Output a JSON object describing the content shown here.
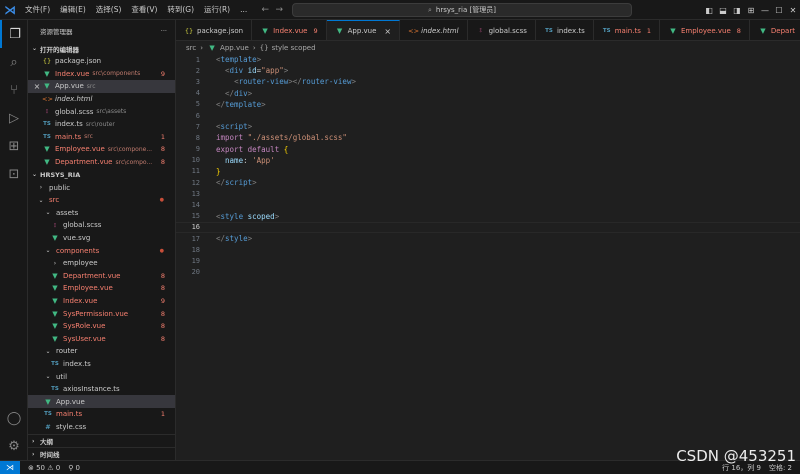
{
  "menu": [
    "文件(F)",
    "编辑(E)",
    "选择(S)",
    "查看(V)",
    "转到(G)",
    "运行(R)",
    "..."
  ],
  "command_center": "hrsys_ria [管理员]",
  "sidebar": {
    "title": "资源管理器",
    "more": "···",
    "open_editors_title": "打开的编辑器",
    "open_editors": [
      {
        "icon": "{}",
        "kind": "json",
        "name": "package.json",
        "dir": "",
        "badge": "",
        "state": ""
      },
      {
        "icon": "▼",
        "kind": "vue",
        "name": "Index.vue",
        "dir": "src\\components",
        "badge": "9",
        "state": "err"
      },
      {
        "icon": "▼",
        "kind": "vue",
        "name": "App.vue",
        "dir": "src",
        "badge": "",
        "state": "",
        "selected": true
      },
      {
        "icon": "<>",
        "kind": "html",
        "name": "index.html",
        "dir": "",
        "badge": "",
        "state": "ital"
      },
      {
        "icon": "⦂",
        "kind": "scss",
        "name": "global.scss",
        "dir": "src\\assets",
        "badge": "",
        "state": ""
      },
      {
        "icon": "TS",
        "kind": "ts",
        "name": "index.ts",
        "dir": "src\\router",
        "badge": "",
        "state": ""
      },
      {
        "icon": "TS",
        "kind": "ts",
        "name": "main.ts",
        "dir": "src",
        "badge": "1",
        "state": "err"
      },
      {
        "icon": "▼",
        "kind": "vue",
        "name": "Employee.vue",
        "dir": "src\\compone...",
        "badge": "8",
        "state": "err"
      },
      {
        "icon": "▼",
        "kind": "vue",
        "name": "Department.vue",
        "dir": "src\\compo...",
        "badge": "8",
        "state": "err"
      }
    ],
    "project_title": "HRSYS_RIA",
    "tree": [
      {
        "indent": 0,
        "icon": "›",
        "kind": "chev",
        "name": "public",
        "state": "",
        "badge": ""
      },
      {
        "indent": 0,
        "icon": "⌄",
        "kind": "chev",
        "name": "src",
        "state": "err",
        "badge": "",
        "dot": true
      },
      {
        "indent": 1,
        "icon": "⌄",
        "kind": "chev",
        "name": "assets",
        "state": "",
        "badge": ""
      },
      {
        "indent": 2,
        "icon": "⦂",
        "kind": "scss",
        "name": "global.scss",
        "state": "",
        "badge": ""
      },
      {
        "indent": 2,
        "icon": "▼",
        "kind": "vue",
        "name": "vue.svg",
        "state": "",
        "badge": ""
      },
      {
        "indent": 1,
        "icon": "⌄",
        "kind": "chev",
        "name": "components",
        "state": "err",
        "badge": "",
        "dot": true
      },
      {
        "indent": 2,
        "icon": "›",
        "kind": "chev",
        "name": "employee",
        "state": "",
        "badge": ""
      },
      {
        "indent": 2,
        "icon": "▼",
        "kind": "vue",
        "name": "Department.vue",
        "state": "err",
        "badge": "8"
      },
      {
        "indent": 2,
        "icon": "▼",
        "kind": "vue",
        "name": "Employee.vue",
        "state": "err",
        "badge": "8"
      },
      {
        "indent": 2,
        "icon": "▼",
        "kind": "vue",
        "name": "Index.vue",
        "state": "err",
        "badge": "9"
      },
      {
        "indent": 2,
        "icon": "▼",
        "kind": "vue",
        "name": "SysPermission.vue",
        "state": "err",
        "badge": "8"
      },
      {
        "indent": 2,
        "icon": "▼",
        "kind": "vue",
        "name": "SysRole.vue",
        "state": "err",
        "badge": "8"
      },
      {
        "indent": 2,
        "icon": "▼",
        "kind": "vue",
        "name": "SysUser.vue",
        "state": "err",
        "badge": "8"
      },
      {
        "indent": 1,
        "icon": "⌄",
        "kind": "chev",
        "name": "router",
        "state": "",
        "badge": ""
      },
      {
        "indent": 2,
        "icon": "TS",
        "kind": "ts",
        "name": "index.ts",
        "state": "",
        "badge": ""
      },
      {
        "indent": 1,
        "icon": "⌄",
        "kind": "chev",
        "name": "util",
        "state": "",
        "badge": ""
      },
      {
        "indent": 2,
        "icon": "TS",
        "kind": "ts",
        "name": "axiosInstance.ts",
        "state": "",
        "badge": ""
      },
      {
        "indent": 1,
        "icon": "▼",
        "kind": "vue",
        "name": "App.vue",
        "state": "",
        "badge": "",
        "selected": true
      },
      {
        "indent": 1,
        "icon": "TS",
        "kind": "ts",
        "name": "main.ts",
        "state": "err",
        "badge": "1"
      },
      {
        "indent": 1,
        "icon": "#",
        "kind": "css",
        "name": "style.css",
        "state": "",
        "badge": ""
      }
    ],
    "outline_title": "大纲",
    "timeline_title": "时间线"
  },
  "tabs": [
    {
      "icon": "{}",
      "kind": "json",
      "name": "package.json",
      "badge": "",
      "state": ""
    },
    {
      "icon": "▼",
      "kind": "vue",
      "name": "Index.vue",
      "badge": "9",
      "state": "err"
    },
    {
      "icon": "▼",
      "kind": "vue",
      "name": "App.vue",
      "badge": "",
      "state": "",
      "active": true,
      "close": "×"
    },
    {
      "icon": "<>",
      "kind": "html",
      "name": "index.html",
      "badge": "",
      "state": "ital"
    },
    {
      "icon": "⦂",
      "kind": "scss",
      "name": "global.scss",
      "badge": "",
      "state": ""
    },
    {
      "icon": "TS",
      "kind": "ts",
      "name": "index.ts",
      "badge": "",
      "state": ""
    },
    {
      "icon": "TS",
      "kind": "ts",
      "name": "main.ts",
      "badge": "1",
      "state": "err"
    },
    {
      "icon": "▼",
      "kind": "vue",
      "name": "Employee.vue",
      "badge": "8",
      "state": "err"
    },
    {
      "icon": "▼",
      "kind": "vue",
      "name": "Depart",
      "badge": "",
      "state": "err"
    }
  ],
  "breadcrumb": [
    "src",
    "App.vue",
    "style scoped"
  ],
  "code": [
    [
      [
        "tg",
        "<"
      ],
      [
        "tn",
        "template"
      ],
      [
        "tg",
        ">"
      ]
    ],
    [
      [
        "tx",
        "  "
      ],
      [
        "tg",
        "<"
      ],
      [
        "tn",
        "div "
      ],
      [
        "at",
        "id"
      ],
      [
        "tx",
        "="
      ],
      [
        "sv",
        "\"app\""
      ],
      [
        "tg",
        ">"
      ]
    ],
    [
      [
        "tx",
        "    "
      ],
      [
        "tg",
        "<"
      ],
      [
        "tn",
        "router-view"
      ],
      [
        "tg",
        "></"
      ],
      [
        "tn",
        "router-view"
      ],
      [
        "tg",
        ">"
      ]
    ],
    [
      [
        "tx",
        "  "
      ],
      [
        "tg",
        "</"
      ],
      [
        "tn",
        "div"
      ],
      [
        "tg",
        ">"
      ]
    ],
    [
      [
        "tg",
        "</"
      ],
      [
        "tn",
        "template"
      ],
      [
        "tg",
        ">"
      ]
    ],
    [],
    [
      [
        "tg",
        "<"
      ],
      [
        "tn",
        "script"
      ],
      [
        "tg",
        ">"
      ]
    ],
    [
      [
        "kw",
        "import "
      ],
      [
        "sv",
        "\"./assets/global.scss\""
      ]
    ],
    [
      [
        "kw",
        "export default "
      ],
      [
        "br",
        "{"
      ]
    ],
    [
      [
        "tx",
        "  "
      ],
      [
        "pr",
        "name"
      ],
      [
        "tx",
        ": "
      ],
      [
        "sv",
        "'App'"
      ]
    ],
    [
      [
        "br",
        "}"
      ]
    ],
    [
      [
        "tg",
        "</"
      ],
      [
        "tn",
        "script"
      ],
      [
        "tg",
        ">"
      ]
    ],
    [],
    [],
    [
      [
        "tg",
        "<"
      ],
      [
        "tn",
        "style "
      ],
      [
        "at",
        "scoped"
      ],
      [
        "tg",
        ">"
      ]
    ],
    [],
    [
      [
        "tg",
        "</"
      ],
      [
        "tn",
        "style"
      ],
      [
        "tg",
        ">"
      ]
    ],
    [],
    [],
    []
  ],
  "current_line": 16,
  "status": {
    "remote": "⋊",
    "problems": "⊗ 50 ⚠ 0",
    "ports": "⚲ 0",
    "position": "行 16，列 9",
    "spaces": "空格: 2"
  },
  "watermark": "CSDN @453251"
}
